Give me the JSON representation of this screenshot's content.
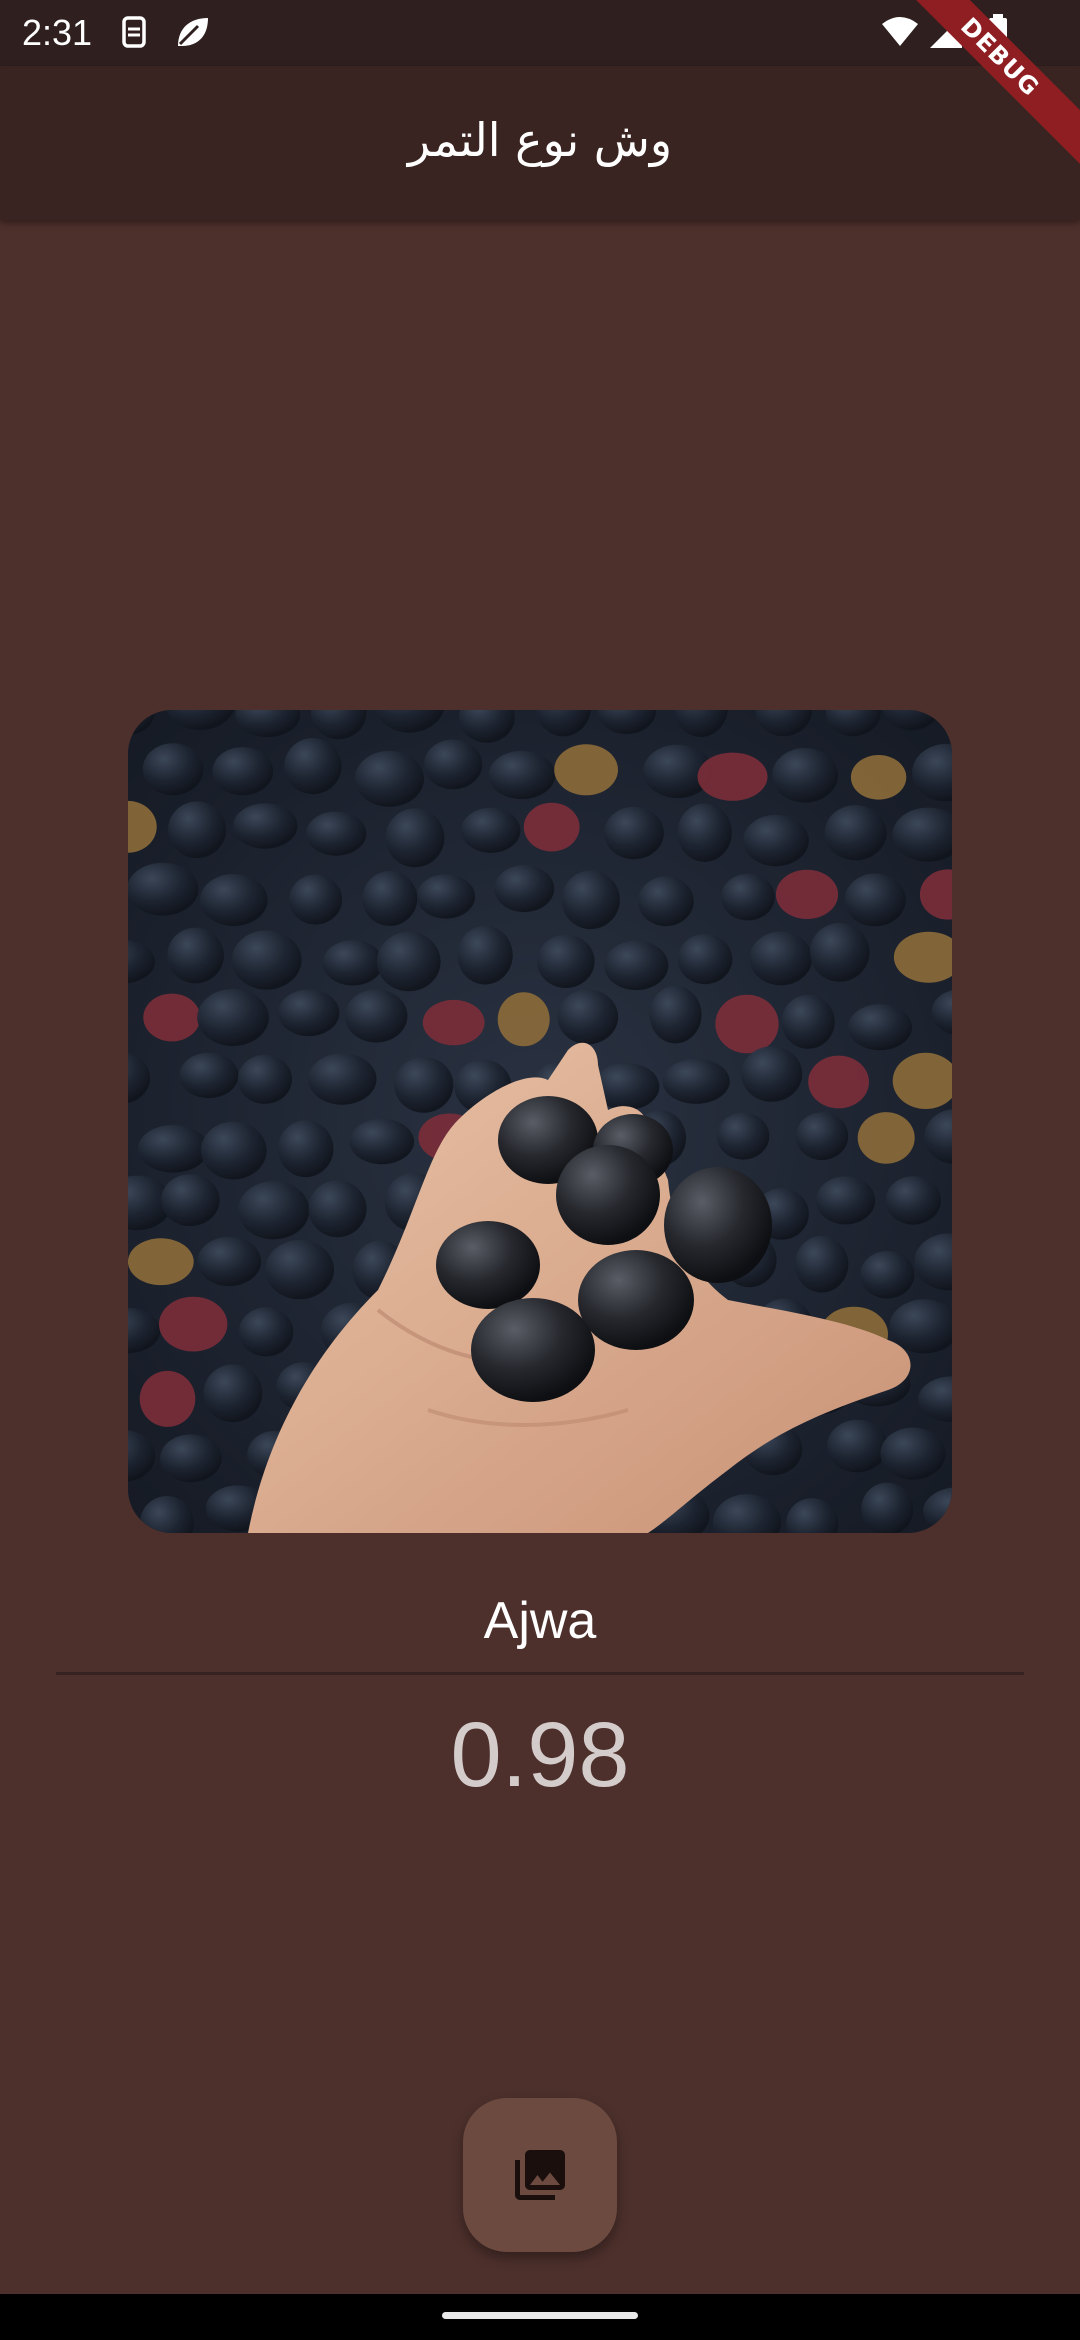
{
  "status_bar": {
    "time": "2:31",
    "left_icons": [
      "sim-card-icon",
      "leaf-icon"
    ],
    "right_icons": [
      "wifi-icon",
      "cell-signal-icon",
      "battery-icon"
    ]
  },
  "app_bar": {
    "title": "وش نوع التمر",
    "background": "#3a2421"
  },
  "debug_banner": {
    "label": "DEBUG",
    "color": "#8f1e22"
  },
  "photo": {
    "subject": "hand-holding-dates-photo"
  },
  "result": {
    "label": "Ajwa",
    "score": "0.98"
  },
  "fab": {
    "icon": "photo-library-icon",
    "color": "#6d4a40"
  },
  "theme": {
    "background": "#4d302c",
    "status_bar_background": "#2f1f1e"
  }
}
